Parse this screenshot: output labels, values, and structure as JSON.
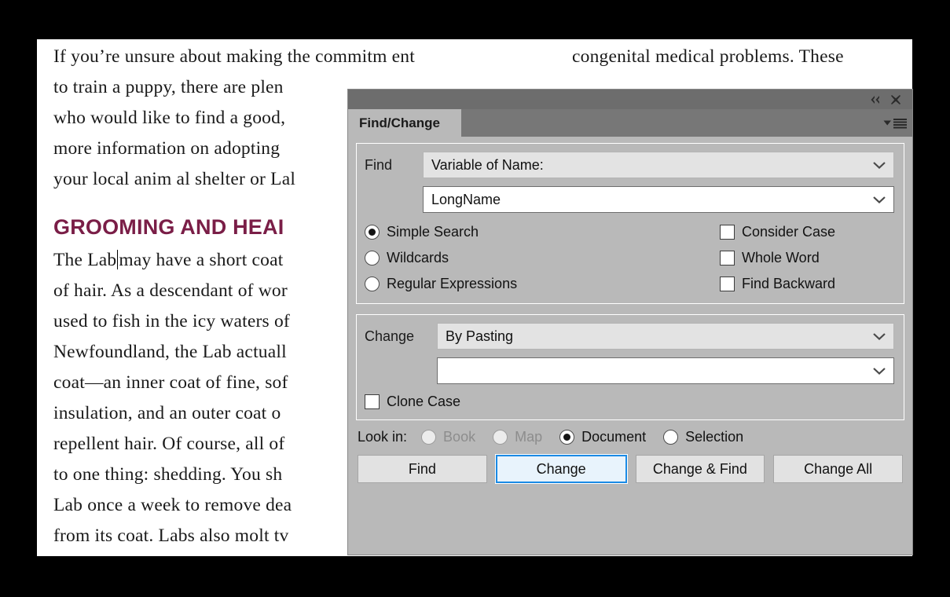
{
  "document": {
    "left_column": {
      "paragraph_lines": [
        "If you’re unsure about making the commitm ent",
        "to train a puppy, there are plen",
        "who would like to find a good,",
        "more information on adopting",
        "your local anim al shelter or Lal"
      ],
      "heading": "GROOMING AND HEAI",
      "body_lines": [
        "The Lab",
        "may have a short  coat",
        "of hair. As a descendant of wor",
        "used to fish in the icy waters of",
        "Newfoundland, the Lab actuall",
        "coat—an inner coat of fine, sof",
        "insulation, and an outer coat o",
        "repellent hair. Of course, all of",
        "to one thing: shedding. You sh",
        "Lab once a week to remove dea",
        "from its coat. Labs also molt tv"
      ]
    },
    "right_column": {
      "lines": [
        "congenital medical problems. These"
      ]
    }
  },
  "panel": {
    "titlebar": {
      "collapse_icon": "double-chevron-left-icon",
      "close_icon": "close-icon"
    },
    "tab": {
      "label": "Find/Change",
      "menu_icon": "panel-menu-icon"
    },
    "find_group": {
      "label": "Find",
      "mode_combo": {
        "value": "Variable of Name:",
        "chevron_icon": "chevron-down-icon"
      },
      "query_combo": {
        "value": "LongName",
        "chevron_icon": "chevron-down-icon"
      },
      "search_modes": [
        {
          "label": "Simple Search",
          "checked": true
        },
        {
          "label": "Wildcards",
          "checked": false
        },
        {
          "label": "Regular Expressions",
          "checked": false
        }
      ],
      "options": [
        {
          "label": "Consider Case",
          "checked": false
        },
        {
          "label": "Whole Word",
          "checked": false
        },
        {
          "label": "Find Backward",
          "checked": false
        }
      ]
    },
    "change_group": {
      "label": "Change",
      "mode_combo": {
        "value": "By Pasting",
        "chevron_icon": "chevron-down-icon"
      },
      "value_combo": {
        "value": "",
        "chevron_icon": "chevron-down-icon"
      },
      "clone_case": {
        "label": "Clone Case",
        "checked": false
      }
    },
    "look_in": {
      "label": "Look in:",
      "options": [
        {
          "label": "Book",
          "checked": false,
          "disabled": true
        },
        {
          "label": "Map",
          "checked": false,
          "disabled": true
        },
        {
          "label": "Document",
          "checked": true,
          "disabled": false
        },
        {
          "label": "Selection",
          "checked": false,
          "disabled": false
        }
      ]
    },
    "buttons": [
      {
        "label": "Find",
        "focused": false
      },
      {
        "label": "Change",
        "focused": true
      },
      {
        "label": "Change & Find",
        "focused": false
      },
      {
        "label": "Change All",
        "focused": false
      }
    ]
  },
  "colors": {
    "panel_background": "#b9b9b9",
    "titlebar": "#6d6d6d",
    "tabstrip": "#777777",
    "heading": "#7a1e47",
    "focus_blue": "#1a8ae5"
  }
}
